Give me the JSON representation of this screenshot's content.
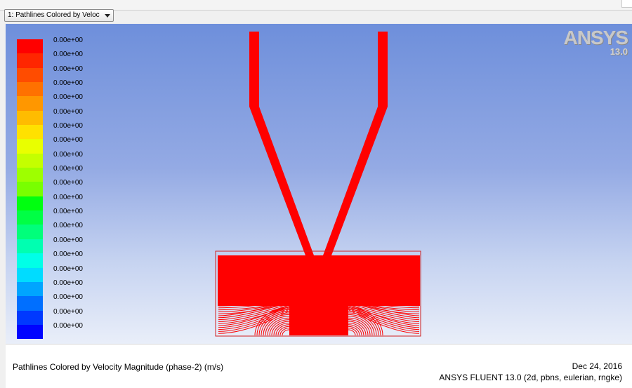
{
  "view_selector": {
    "value": "1: Pathlines Colored by Veloc"
  },
  "logo": {
    "brand": "ANSYS",
    "version": "13.0"
  },
  "legend": {
    "colors": [
      "#ff0000",
      "#ff2600",
      "#ff4c00",
      "#ff7100",
      "#ff9700",
      "#ffbc00",
      "#ffe100",
      "#e9ff00",
      "#c4ff00",
      "#9eff00",
      "#79ff00",
      "#00ff10",
      "#00ff45",
      "#00ff7b",
      "#00ffb1",
      "#00ffe7",
      "#00dcff",
      "#00a5ff",
      "#006fff",
      "#0039ff",
      "#0004ff"
    ],
    "labels": [
      "0.00e+00",
      "0.00e+00",
      "0.00e+00",
      "0.00e+00",
      "0.00e+00",
      "0.00e+00",
      "0.00e+00",
      "0.00e+00",
      "0.00e+00",
      "0.00e+00",
      "0.00e+00",
      "0.00e+00",
      "0.00e+00",
      "0.00e+00",
      "0.00e+00",
      "0.00e+00",
      "0.00e+00",
      "0.00e+00",
      "0.00e+00",
      "0.00e+00",
      "0.00e+00"
    ]
  },
  "footer": {
    "title": "Pathlines Colored by Velocity Magnitude (phase-2)  (m/s)",
    "date": "Dec 24, 2016",
    "product": "ANSYS FLUENT 13.0 (2d, pbns, eulerian, rngke)"
  },
  "colors": {
    "pathline": "#ff0000",
    "outline": "#d02020"
  }
}
